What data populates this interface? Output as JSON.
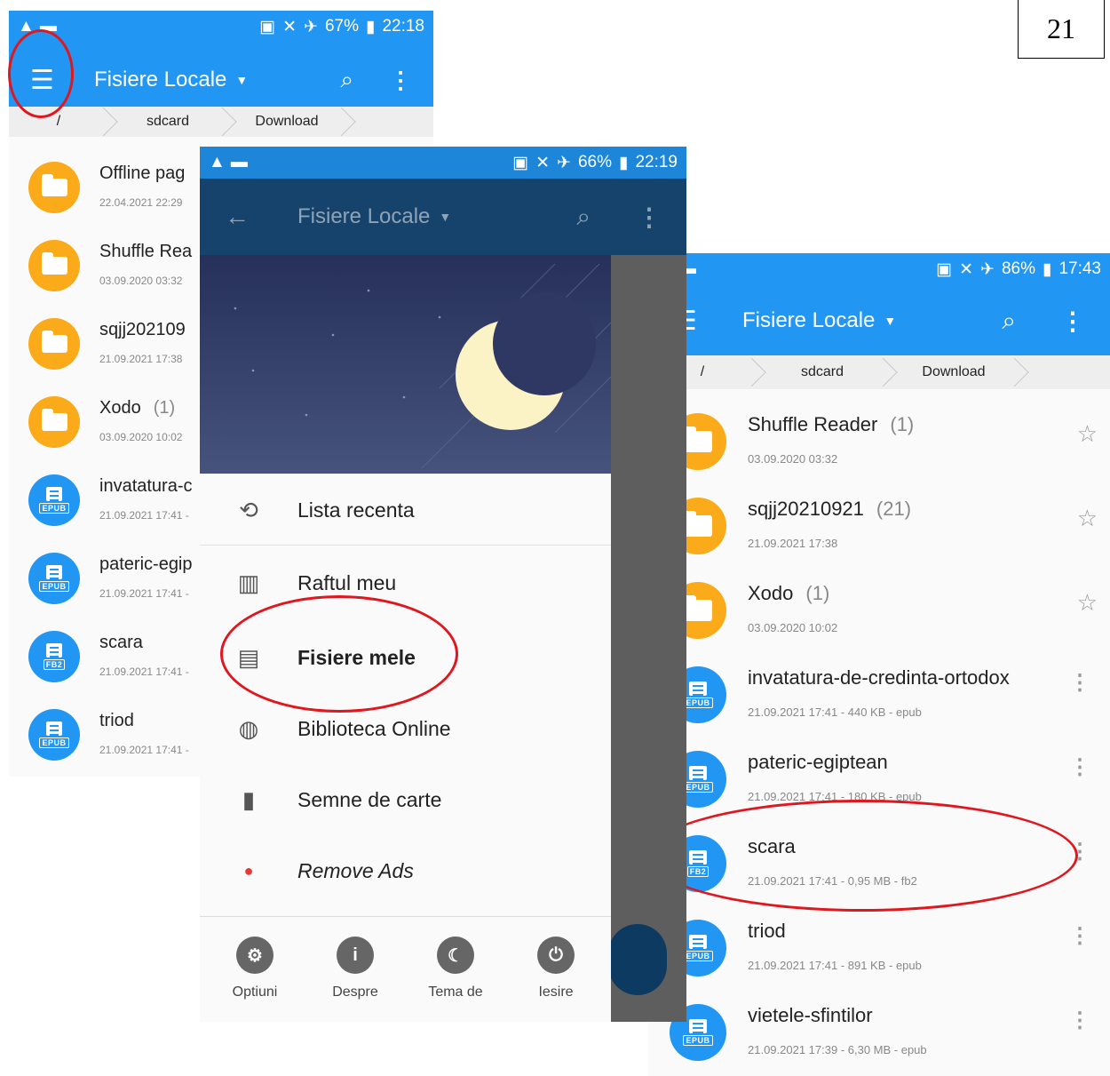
{
  "page_number": "21",
  "accent_blue": "#2196f3",
  "folder_orange": "#fbaa19",
  "screen1": {
    "status": {
      "battery": "67%",
      "time": "22:18"
    },
    "title": "Fisiere Locale",
    "breadcrumb": [
      "/",
      "sdcard",
      "Download"
    ],
    "items": [
      {
        "name": "Offline pag",
        "meta": "22.04.2021 22:29",
        "type": "folder"
      },
      {
        "name": "Shuffle Rea",
        "meta": "03.09.2020 03:32",
        "type": "folder"
      },
      {
        "name": "sqjj202109",
        "meta": "21.09.2021 17:38",
        "type": "folder"
      },
      {
        "name": "Xodo",
        "count": "(1)",
        "meta": "03.09.2020 10:02",
        "type": "folder"
      },
      {
        "name": "invatatura-c",
        "meta": "21.09.2021 17:41 -",
        "type": "book",
        "badge": "EPUB"
      },
      {
        "name": "pateric-egip",
        "meta": "21.09.2021 17:41 -",
        "type": "book",
        "badge": "EPUB"
      },
      {
        "name": "scara",
        "meta": "21.09.2021 17:41 -",
        "type": "book",
        "badge": "FB2"
      },
      {
        "name": "triod",
        "meta": "21.09.2021 17:41 -",
        "type": "book",
        "badge": "EPUB"
      }
    ]
  },
  "screen2": {
    "status": {
      "battery": "66%",
      "time": "22:19"
    },
    "title": "Fisiere Locale",
    "menu": [
      {
        "label": "Lista recenta",
        "icon": "history-icon"
      },
      {
        "label": "Raftul meu",
        "icon": "bookshelf-icon"
      },
      {
        "label": "Fisiere mele",
        "icon": "file-icon"
      },
      {
        "label": "Biblioteca Online",
        "icon": "globe-icon"
      },
      {
        "label": "Semne de carte",
        "icon": "bookmark-icon"
      },
      {
        "label": "Remove Ads",
        "icon": "red-dot-icon"
      }
    ],
    "bottom": [
      {
        "label": "Optiuni",
        "icon": "settings-icon"
      },
      {
        "label": "Despre",
        "icon": "info-icon"
      },
      {
        "label": "Tema de",
        "icon": "moon-icon"
      },
      {
        "label": "Iesire",
        "icon": "power-icon"
      }
    ]
  },
  "screen3": {
    "status": {
      "battery": "86%",
      "time": "17:43"
    },
    "title": "Fisiere Locale",
    "breadcrumb": [
      "/",
      "sdcard",
      "Download"
    ],
    "items": [
      {
        "name": "Shuffle Reader",
        "count": "(1)",
        "meta": "03.09.2020 03:32",
        "type": "folder"
      },
      {
        "name": "sqjj20210921",
        "count": "(21)",
        "meta": "21.09.2021 17:38",
        "type": "folder"
      },
      {
        "name": "Xodo",
        "count": "(1)",
        "meta": "03.09.2020 10:02",
        "type": "folder"
      },
      {
        "name": "invatatura-de-credinta-ortodox",
        "meta": "21.09.2021 17:41 - 440 KB - epub",
        "type": "book",
        "badge": "EPUB"
      },
      {
        "name": "pateric-egiptean",
        "meta": "21.09.2021 17:41 - 180 KB - epub",
        "type": "book",
        "badge": "EPUB"
      },
      {
        "name": "scara",
        "meta": "21.09.2021 17:41 - 0,95 MB - fb2",
        "type": "book",
        "badge": "FB2"
      },
      {
        "name": "triod",
        "meta": "21.09.2021 17:41 - 891 KB - epub",
        "type": "book",
        "badge": "EPUB"
      },
      {
        "name": "vietele-sfintilor",
        "meta": "21.09.2021 17:39 - 6,30 MB - epub",
        "type": "book",
        "badge": "EPUB"
      }
    ]
  }
}
